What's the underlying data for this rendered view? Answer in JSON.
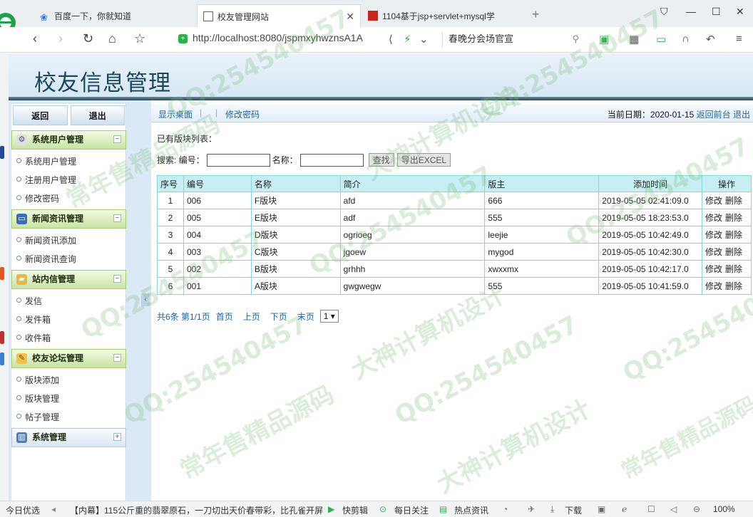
{
  "browser": {
    "tabs": [
      {
        "title": "百度一下，你就知道"
      },
      {
        "title": "校友管理网站"
      },
      {
        "title": "1104基于jsp+servlet+mysql学"
      }
    ],
    "url": "http://localhost:8080/jspmxyhwznsA1A",
    "search_text": "春晚分会场官宣"
  },
  "page": {
    "header_title": "校友信息管理",
    "back_label": "返回",
    "logout_label": "退出"
  },
  "menu": [
    {
      "title": "系统用户管理",
      "toggle": "−",
      "items": [
        "系统用户管理",
        "注册用户管理",
        "修改密码"
      ]
    },
    {
      "title": "新闻资讯管理",
      "toggle": "−",
      "items": [
        "新闻资讯添加",
        "新闻资讯查询"
      ]
    },
    {
      "title": "站内信管理",
      "toggle": "−",
      "items": [
        "发信",
        "发件箱",
        "收件箱"
      ]
    },
    {
      "title": "校友论坛管理",
      "toggle": "−",
      "items": [
        "版块添加",
        "版块管理",
        "帖子管理"
      ]
    },
    {
      "title": "系统管理",
      "toggle": "+",
      "items": []
    }
  ],
  "toolbar": {
    "show_desktop": "显示桌面",
    "change_password": "修改密码",
    "date_label": "当前日期：2020-01-15",
    "back_front": "返回前台",
    "logout": "退出"
  },
  "content": {
    "list_title": "已有版块列表：",
    "search_label": "搜索: 编号：",
    "name_label": "名称：",
    "search_button": "查找",
    "export_button": "导出EXCEL"
  },
  "table": {
    "headers": [
      "序号",
      "编号",
      "名称",
      "简介",
      "版主",
      "添加时间",
      "操作"
    ],
    "rows": [
      [
        "1",
        "006",
        "F版块",
        "afd",
        "666",
        "2019-05-05 02:41:09.0"
      ],
      [
        "2",
        "005",
        "E版块",
        "adf",
        "555",
        "2019-05-05 18:23:53.0"
      ],
      [
        "3",
        "004",
        "D版块",
        "ogrioeg",
        "leejie",
        "2019-05-05 10:42:49.0"
      ],
      [
        "4",
        "003",
        "C版块",
        "jgoew",
        "mygod",
        "2019-05-05 10:42:30.0"
      ],
      [
        "5",
        "002",
        "B版块",
        "grhhh",
        "xwxxmx",
        "2019-05-05 10:42:17.0"
      ],
      [
        "6",
        "001",
        "A版块",
        "gwgwegw",
        "555",
        "2019-05-05 10:41:59.0"
      ]
    ],
    "edit_label": "修改",
    "delete_label": "删除"
  },
  "pager": {
    "summary": "共6条  第1/1页",
    "first": "首页",
    "prev": "上页",
    "next": "下页",
    "last": "末页",
    "page_select": "1 ▾"
  },
  "statusbar": {
    "left": "今日优选",
    "news": "【内幕】115公斤重的翡翠原石，一刀切出天价春带彩，比孔雀开屏",
    "clip": "快剪辑",
    "follow": "每日关注",
    "hot": "热点资讯",
    "download": "下载",
    "zoom": "100%"
  },
  "watermark": {
    "qq": "QQ:254540457",
    "slogan1": "大神计算机设计",
    "slogan2": "常年售精品源码"
  }
}
